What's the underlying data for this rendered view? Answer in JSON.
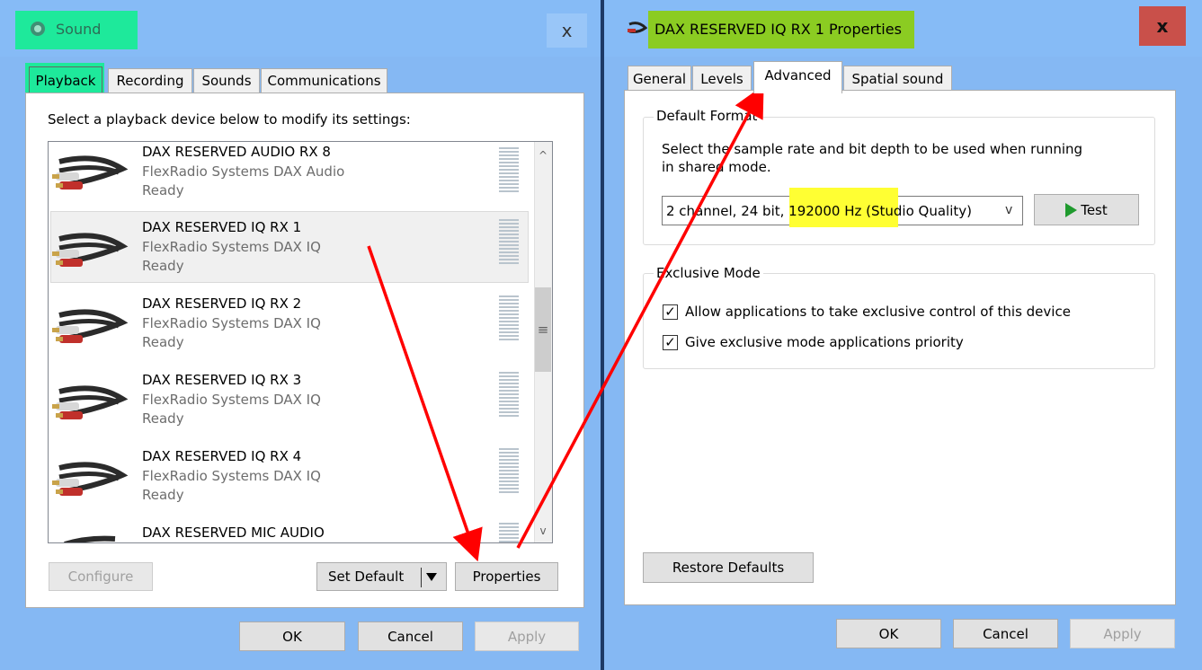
{
  "sound": {
    "title": "Sound",
    "close": "x",
    "tabs": [
      "Playback",
      "Recording",
      "Sounds",
      "Communications"
    ],
    "instruction": "Select a playback device below to modify its settings:",
    "devices": [
      {
        "name": "DAX RESERVED AUDIO RX 8",
        "driver": "FlexRadio Systems DAX Audio",
        "status": "Ready"
      },
      {
        "name": "DAX RESERVED IQ RX 1",
        "driver": "FlexRadio Systems DAX IQ",
        "status": "Ready"
      },
      {
        "name": "DAX RESERVED IQ RX 2",
        "driver": "FlexRadio Systems DAX IQ",
        "status": "Ready"
      },
      {
        "name": "DAX RESERVED IQ RX 3",
        "driver": "FlexRadio Systems DAX IQ",
        "status": "Ready"
      },
      {
        "name": "DAX RESERVED IQ RX 4",
        "driver": "FlexRadio Systems DAX IQ",
        "status": "Ready"
      },
      {
        "name": "DAX RESERVED MIC AUDIO"
      }
    ],
    "scroll_up": "^",
    "scroll_down": "v",
    "scroll_grip": "≡",
    "configure": "Configure",
    "set_default": "Set Default",
    "properties": "Properties",
    "ok": "OK",
    "cancel": "Cancel",
    "apply": "Apply"
  },
  "props": {
    "title": "DAX RESERVED IQ RX 1 Properties",
    "close": "x",
    "tabs": [
      "General",
      "Levels",
      "Advanced",
      "Spatial sound"
    ],
    "default_format": {
      "legend": "Default Format",
      "description_line1": "Select the sample rate and bit depth to be used when running",
      "description_line2": "in shared mode.",
      "format_prefix": "2 channel, 24 bit,",
      "format_highlight": " 192000 Hz (Studio Quality)",
      "dropdown_arrow": "v",
      "test": "Test"
    },
    "exclusive": {
      "legend": "Exclusive Mode",
      "allow": "Allow applications to take exclusive control of this device",
      "allow_checked": true,
      "priority": "Give exclusive mode applications priority",
      "priority_checked": true
    },
    "restore": "Restore Defaults",
    "ok": "OK",
    "cancel": "Cancel",
    "apply": "Apply"
  },
  "colors": {
    "titlebar": "#86bbf6",
    "highlight_green": "#1ee99b",
    "highlight_lime": "#8bcc22",
    "highlight_yellow": "#ffff33",
    "annotation_arrow": "#ff0000"
  }
}
